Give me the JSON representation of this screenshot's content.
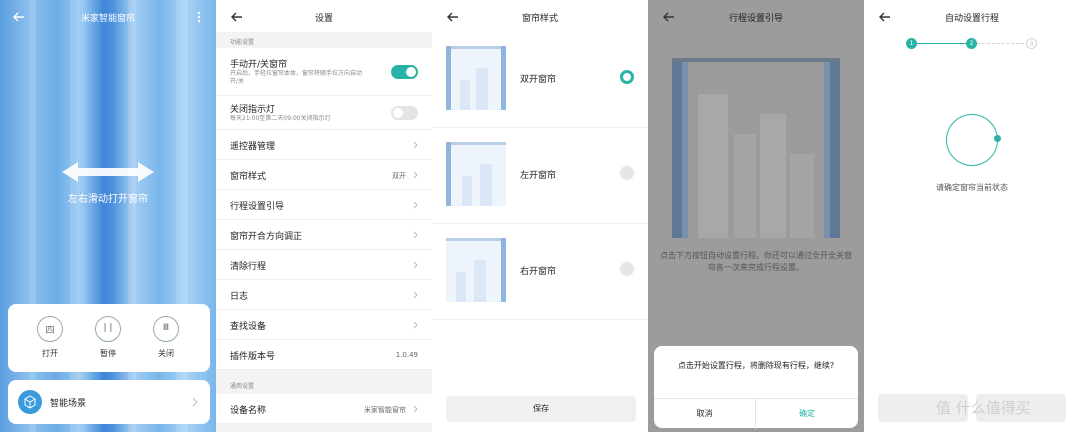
{
  "panel1": {
    "title": "米家智能窗帘",
    "hint": "左右滑动打开窗帘",
    "controls": [
      {
        "label": "打开",
        "glyph": "四"
      },
      {
        "label": "暂停",
        "glyph": "| |"
      },
      {
        "label": "关闭",
        "glyph": "Ⅲ"
      }
    ],
    "scene_label": "智能场景"
  },
  "panel2": {
    "title": "设置",
    "section_function": "功能设置",
    "manual": {
      "title": "手动开/关窗帘",
      "subtitle": "开启后，手轻拉窗帘本体，窗帘将随手拉方向自动开/关",
      "on": true
    },
    "indicator": {
      "title": "关闭指示灯",
      "subtitle": "每天21:00至第二天09:00关闭指示灯",
      "on": false
    },
    "items": [
      {
        "label": "遥控器管理",
        "value": ""
      },
      {
        "label": "窗帘样式",
        "value": "双开"
      },
      {
        "label": "行程设置引导",
        "value": ""
      },
      {
        "label": "窗帘开合方向调正",
        "value": ""
      },
      {
        "label": "清除行程",
        "value": ""
      },
      {
        "label": "日志",
        "value": ""
      },
      {
        "label": "查找设备",
        "value": ""
      }
    ],
    "plugin": {
      "label": "插件版本号",
      "value": "1.0.49"
    },
    "section_general": "通用设置",
    "device_name": {
      "label": "设备名称",
      "value": "米家智能窗帘"
    }
  },
  "panel3": {
    "title": "窗帘样式",
    "options": [
      {
        "label": "双开窗帘",
        "selected": true
      },
      {
        "label": "左开窗帘",
        "selected": false
      },
      {
        "label": "右开窗帘",
        "selected": false
      }
    ],
    "save": "保存"
  },
  "panel4": {
    "title": "行程设置引导",
    "guide": "点击下方按钮自动设置行程。你还可以通过全开全关窗帘各一次来完成行程设置。",
    "dialog_message": "点击开始设置行程，将删除现有行程，继续?",
    "cancel": "取消",
    "confirm": "确定"
  },
  "panel5": {
    "title": "自动设置行程",
    "steps": [
      "1",
      "2",
      "3"
    ],
    "current_step": 2,
    "state_text": "请确定窗帘当前状态"
  },
  "watermark": "值 什么值得买",
  "colors": {
    "accent": "#29b3a6",
    "sky": "#7ab6ea",
    "dim": "#9c9c9c"
  }
}
